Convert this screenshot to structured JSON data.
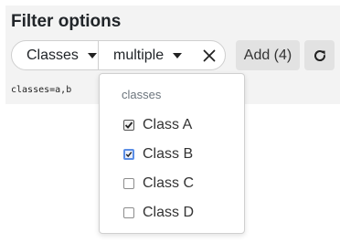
{
  "title": "Filter options",
  "filter": {
    "field": "Classes",
    "mode": "multiple"
  },
  "add_label": "Add (4)",
  "query": "classes=a,b",
  "dropdown": {
    "header": "classes",
    "options": [
      {
        "label": "Class A",
        "checked": true
      },
      {
        "label": "Class B",
        "checked": true
      },
      {
        "label": "Class C",
        "checked": false
      },
      {
        "label": "Class D",
        "checked": false
      }
    ]
  },
  "icons": {
    "caret": "chevron-down-icon",
    "close": "close-icon",
    "refresh": "refresh-icon"
  }
}
